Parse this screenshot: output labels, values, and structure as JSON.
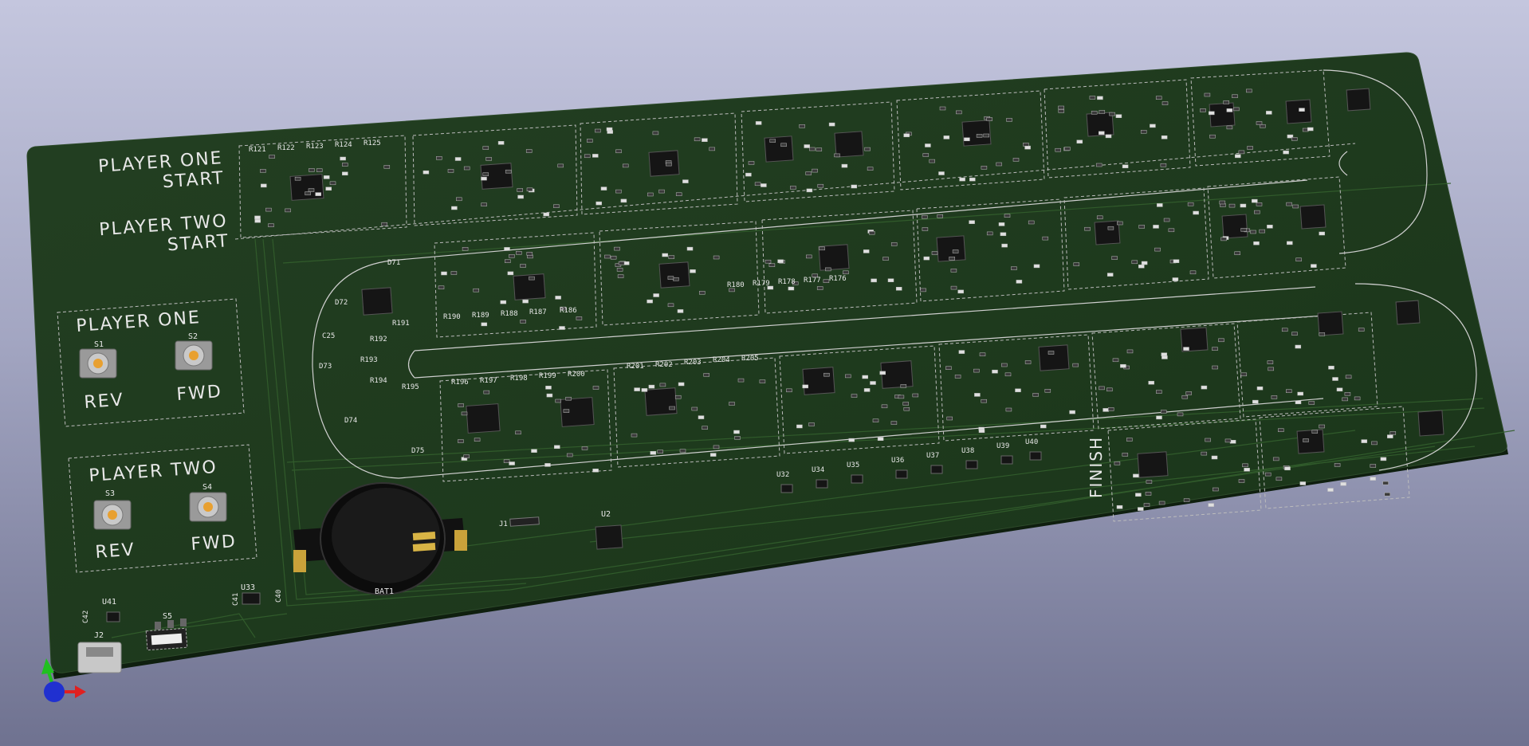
{
  "board": {
    "color": "#1f3a1f",
    "trace_color": "#2f5a2a",
    "silk_color": "#e8e8e8"
  },
  "labels": {
    "player_one_start_l1": "PLAYER ONE",
    "player_one_start_l2": "START",
    "player_two_start_l1": "PLAYER TWO",
    "player_two_start_l2": "START",
    "finish": "FINISH",
    "player_one": "PLAYER ONE",
    "player_two": "PLAYER TWO",
    "rev": "REV",
    "fwd": "FWD"
  },
  "refs": {
    "s1": "S1",
    "s2": "S2",
    "s3": "S3",
    "s4": "S4",
    "s5": "S5",
    "bat1": "BAT1",
    "j1": "J1",
    "j2": "J2",
    "u2": "U2",
    "u33": "U33",
    "u41": "U41",
    "c40": "C40",
    "c41": "C41",
    "c42": "C42",
    "c25": "C25",
    "u32": "U32",
    "u34": "U34",
    "u35": "U35",
    "u36": "U36",
    "u37": "U37",
    "u38": "U38",
    "u39": "U39",
    "u40": "U40",
    "r191": "R191",
    "r192": "R192",
    "r193": "R193",
    "r194": "R194",
    "r195": "R195",
    "d72": "D72",
    "d73": "D73",
    "d74": "D74",
    "d75": "D75",
    "d71": "D71",
    "r121": "R121",
    "r122": "R122",
    "r123": "R123",
    "r124": "R124",
    "r125": "R125",
    "r176": "R176",
    "r177": "R177",
    "r178": "R178",
    "r179": "R179",
    "r180": "R180",
    "r186": "R186",
    "r187": "R187",
    "r188": "R188",
    "r189": "R189",
    "r190": "R190",
    "r196": "R196",
    "r197": "R197",
    "r198": "R198",
    "r199": "R199",
    "r200": "R200",
    "r201": "R201",
    "r202": "R202",
    "r203": "R203",
    "r204": "R204",
    "r205": "R205"
  },
  "icons": {
    "axis_gizmo": "axis-gizmo-icon"
  },
  "colors": {
    "background_top": "#c4c6de",
    "background_bottom": "#6f7290",
    "axis_x": "#e02020",
    "axis_y": "#20c020",
    "axis_z": "#2030d0"
  }
}
